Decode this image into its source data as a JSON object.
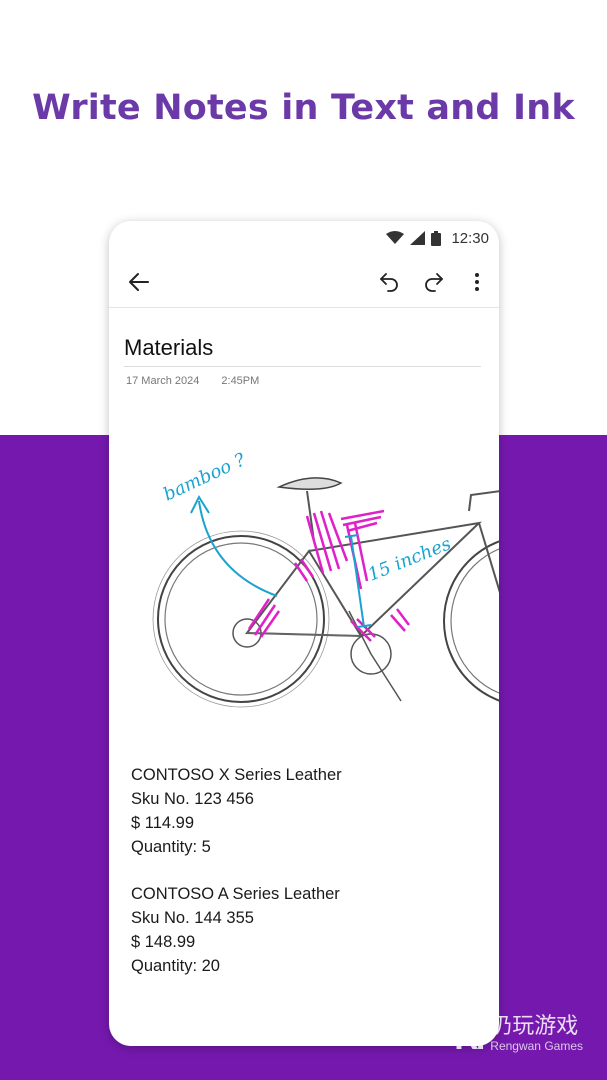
{
  "headline": "Write Notes in Text and Ink",
  "status_bar": {
    "time": "12:30"
  },
  "toolbar": {
    "back_icon": "arrow-left-icon",
    "undo_icon": "undo-icon",
    "redo_icon": "redo-icon",
    "more_icon": "more-vertical-icon"
  },
  "note": {
    "title": "Materials",
    "date": "17 March 2024",
    "time": "2:45PM",
    "ink_annotations": {
      "bamboo": "bamboo ?",
      "measure": "15 inches"
    },
    "items": [
      {
        "name": "CONTOSO X Series Leather",
        "sku": "Sku No. 123 456",
        "price": "$ 114.99",
        "quantity": "Quantity: 5"
      },
      {
        "name": "CONTOSO A Series Leather",
        "sku": "Sku No. 144 355",
        "price": "$ 148.99",
        "quantity": "Quantity: 20"
      }
    ]
  },
  "watermark": {
    "logo": "RI",
    "cn": "仍玩游戏",
    "en": "Rengwan Games"
  },
  "colors": {
    "headline": "#6b3aa8",
    "band": "#7519ae",
    "ink_blue": "#1aa3cf",
    "ink_magenta": "#e020c8"
  }
}
